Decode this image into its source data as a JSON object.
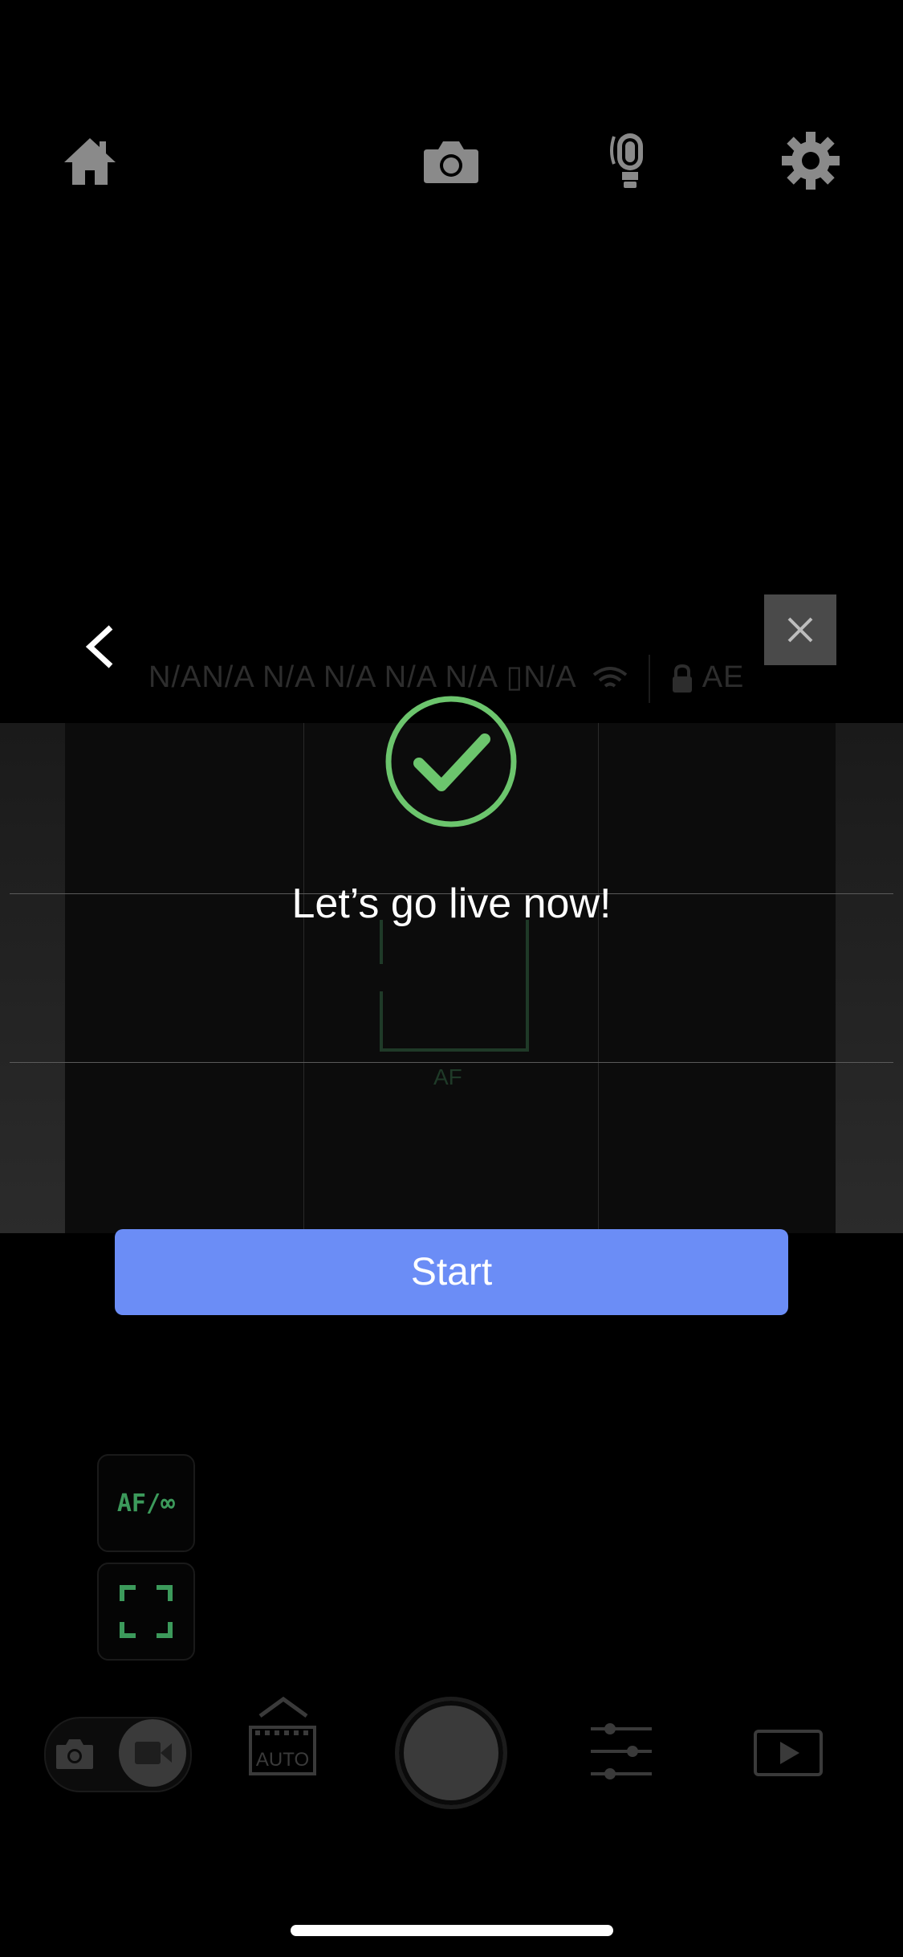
{
  "status_bar": {
    "text": "N/AN/A N/A N/A N/A N/A ▯N/A",
    "ae_label": "AE"
  },
  "dialog": {
    "message": "Let’s go live now!",
    "start_label": "Start"
  },
  "focus": {
    "af_label": "AF",
    "af_infinity_label": "AF/∞"
  },
  "toolbar": {
    "auto_label": "AUTO"
  },
  "colors": {
    "accent_blue": "#6b8df6",
    "success_green": "#6cc56d",
    "focus_green": "#3c9a5b"
  }
}
